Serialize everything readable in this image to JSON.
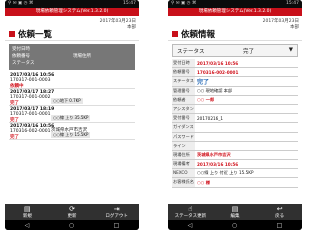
{
  "status_bar": {
    "left": "⚲ ✉ ▣ ◷ ⌘",
    "right": "15:47"
  },
  "app_title": "現場依頼管理システム(Ver.1.3.2.0)",
  "list_screen": {
    "date": "2017年03月23日",
    "user": "本部",
    "title": "依頼一覧",
    "header": {
      "l1": "受付日時",
      "l2": "依頼番号",
      "l3": "ステータス",
      "r1": "現場住所"
    },
    "items": [
      {
        "date": "2017/03/16 10:56",
        "no": "170317-001-0003",
        "status": "依頼中",
        "loc": "",
        "chip": ""
      },
      {
        "date": "2017/03/17 18:27",
        "no": "170317-001-0002",
        "status": "完了",
        "loc": "",
        "chip": "○○地下 0.7KP"
      },
      {
        "date": "2017/03/17 18:19",
        "no": "170317-001-0001",
        "status": "完了",
        "loc": "",
        "chip": "○○線 上り 35.5KP"
      },
      {
        "date": "2017/03/16 10:56",
        "no": "170316-002-0001",
        "status": "完了",
        "loc": "茨城県水戸市吉沢",
        "chip": "○○線 上り 15.5KP"
      }
    ],
    "buttons": [
      "新規",
      "更新",
      "ログアウト"
    ]
  },
  "detail_screen": {
    "date": "2017年03月23日",
    "user": "本部",
    "title": "依頼情報",
    "segment_left": "ステータス",
    "segment_value": "完了",
    "rows": [
      {
        "k": "受付日時",
        "v": "2017/03/16 10:56"
      },
      {
        "k": "依頼番号",
        "v": "170316-002-0001"
      },
      {
        "k": "ステータス",
        "v": "完了"
      },
      {
        "k": "管理番号",
        "v": "○○  現地確認 本部"
      },
      {
        "k": "依頼者",
        "v": "○○ 一郎"
      },
      {
        "k": "アシスタント",
        "v": ""
      },
      {
        "k": "受付番号",
        "v": "20170216_1"
      },
      {
        "k": "ガイダンス",
        "v": ""
      },
      {
        "k": "パスワード",
        "v": ""
      },
      {
        "k": "ライン",
        "v": ""
      },
      {
        "k": "現場住所",
        "v": "茨城県水戸市吉沢"
      },
      {
        "k": "現場備考",
        "v": "2017/03/16 10:56"
      },
      {
        "k": "NEXCO",
        "v": "○○線 上り 付近 上り 15.5KP"
      },
      {
        "k": "お客様氏名",
        "v": "○○ 様"
      }
    ],
    "buttons": [
      "ステータス更新",
      "編集",
      "戻る"
    ]
  },
  "nav": [
    "◁",
    "○",
    "□"
  ]
}
